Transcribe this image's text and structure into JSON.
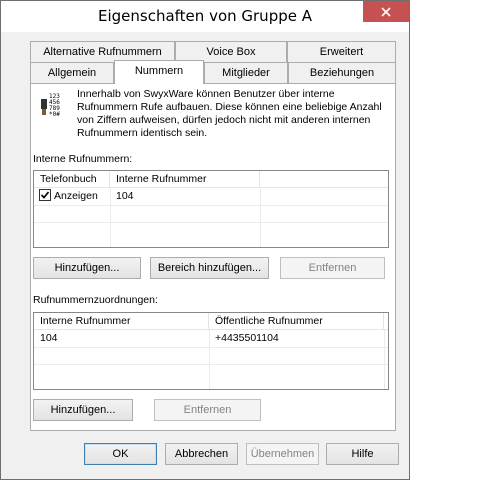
{
  "window": {
    "title": "Eigenschaften von Gruppe A",
    "close_icon": "close-icon"
  },
  "tabs": {
    "row1": [
      "Alternative Rufnummern",
      "Voice Box",
      "Erweitert"
    ],
    "row2": [
      "Allgemein",
      "Nummern",
      "Mitglieder",
      "Beziehungen"
    ],
    "active": "Nummern"
  },
  "info": {
    "icon": "numbers-icon",
    "text": "Innerhalb von SwyxWare können Benutzer über interne Rufnummern Rufe aufbauen. Diese können eine beliebige Anzahl von Ziffern aufweisen, dürfen jedoch nicht mit anderen internen Rufnummern identisch sein."
  },
  "internal": {
    "label": "Interne Rufnummern:",
    "columns": [
      "Telefonbuch",
      "Interne Rufnummer"
    ],
    "rows": [
      {
        "phonebook": "Anzeigen",
        "checked": true,
        "number": "104"
      }
    ],
    "buttons": {
      "add": "Hinzufügen...",
      "add_range": "Bereich hinzufügen...",
      "remove": "Entfernen"
    }
  },
  "mapping": {
    "label": "Rufnummernzuordnungen:",
    "columns": [
      "Interne Rufnummer",
      "Öffentliche Rufnummer"
    ],
    "rows": [
      {
        "internal": "104",
        "public": "+4435501104"
      }
    ],
    "buttons": {
      "add": "Hinzufügen...",
      "remove": "Entfernen"
    }
  },
  "footer": {
    "ok": "OK",
    "cancel": "Abbrechen",
    "apply": "Übernehmen",
    "help": "Hilfe"
  }
}
